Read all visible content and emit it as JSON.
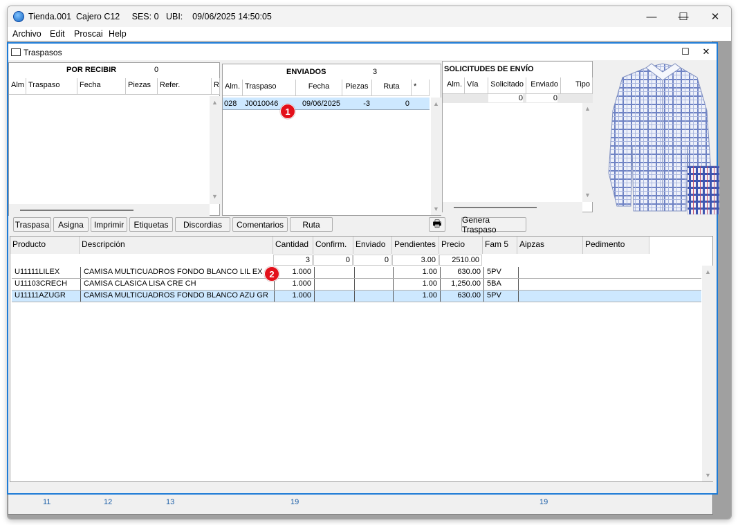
{
  "window": {
    "title": "Tienda.001  Cajero C12     SES: 0   UBI:    09/06/2025 14:50:05",
    "minimize": "—",
    "maximize": "☐",
    "close": "✕"
  },
  "menu": [
    "Archivo",
    "Edit",
    "Proscai",
    "Help"
  ],
  "background_labels": [
    "11",
    "12",
    "13",
    "19",
    "19"
  ],
  "child": {
    "title": "Traspasos",
    "maximize": "☐",
    "close": "✕"
  },
  "por_recibir": {
    "title": "POR RECIBIR",
    "count": "0",
    "columns": [
      "Alm",
      "Traspaso",
      "Fecha",
      "Piezas",
      "Refer.",
      "R"
    ]
  },
  "enviados": {
    "title": "ENVIADOS",
    "count": "3",
    "columns": [
      "Alm.",
      "Traspaso",
      "Fecha",
      "Piezas",
      "Ruta",
      "*"
    ],
    "rows": [
      {
        "alm": "028",
        "traspaso": "J0010046",
        "fecha": "09/06/2025",
        "piezas": "-3",
        "ruta": "0"
      }
    ]
  },
  "solicitudes": {
    "title": "SOLICITUDES DE ENVÍO",
    "columns": [
      "Alm.",
      "Vía",
      "Solicitado",
      "Enviado",
      "Tipo"
    ],
    "totals": {
      "solicitado": "0",
      "enviado": "0"
    }
  },
  "buttons": [
    "Traspasa",
    "Asigna",
    "Imprimir",
    "Etiquetas",
    "Discordias",
    "Comentarios",
    "Ruta",
    "Genera Traspaso"
  ],
  "print_icon": "🖶",
  "badges": [
    "1",
    "2"
  ],
  "detail": {
    "columns": [
      "Producto",
      "Descripción",
      "Cantidad",
      "Confirm.",
      "Enviado",
      "Pendientes",
      "Precio",
      "Fam 5",
      "Aipzas",
      "Pedimento"
    ],
    "totals": {
      "cantidad": "3",
      "confirm": "0",
      "enviado": "0",
      "pendientes": "3.00",
      "precio": "2510.00"
    },
    "rows": [
      {
        "producto": "U11111LILEX",
        "descripcion": "CAMISA MULTICUADROS FONDO BLANCO LIL EX",
        "cantidad": "1.000",
        "pendientes": "1.00",
        "precio": "630.00",
        "fam5": "5PV"
      },
      {
        "producto": "U11103CRECH",
        "descripcion": "CAMISA CLASICA LISA CRE CH",
        "cantidad": "1.000",
        "pendientes": "1.00",
        "precio": "1,250.00",
        "fam5": "5BA"
      },
      {
        "producto": "U11111AZUGR",
        "descripcion": "CAMISA MULTICUADROS FONDO BLANCO AZU GR",
        "cantidad": "1.000",
        "pendientes": "1.00",
        "precio": "630.00",
        "fam5": "5PV"
      }
    ]
  }
}
